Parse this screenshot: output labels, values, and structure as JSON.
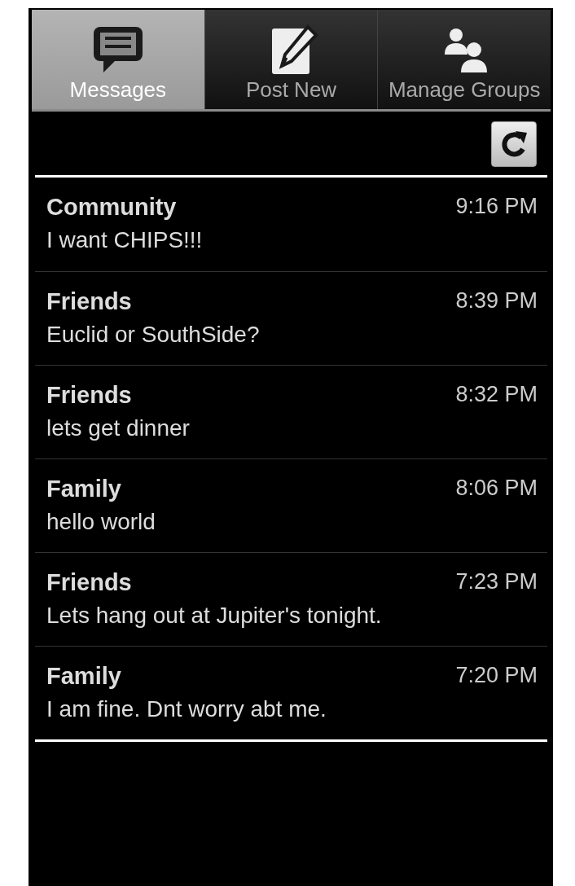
{
  "tabs": [
    {
      "label": "Messages",
      "selected": true
    },
    {
      "label": "Post New",
      "selected": false
    },
    {
      "label": "Manage Groups",
      "selected": false
    }
  ],
  "messages": [
    {
      "group": "Community",
      "time": "9:16 PM",
      "text": "I want CHIPS!!!"
    },
    {
      "group": "Friends",
      "time": "8:39 PM",
      "text": "Euclid or SouthSide?"
    },
    {
      "group": "Friends",
      "time": "8:32 PM",
      "text": "lets get dinner"
    },
    {
      "group": "Family",
      "time": "8:06 PM",
      "text": "hello world"
    },
    {
      "group": "Friends",
      "time": "7:23 PM",
      "text": "Lets hang out at Jupiter's tonight."
    },
    {
      "group": "Family",
      "time": "7:20 PM",
      "text": "I am fine. Dnt worry abt me."
    }
  ]
}
